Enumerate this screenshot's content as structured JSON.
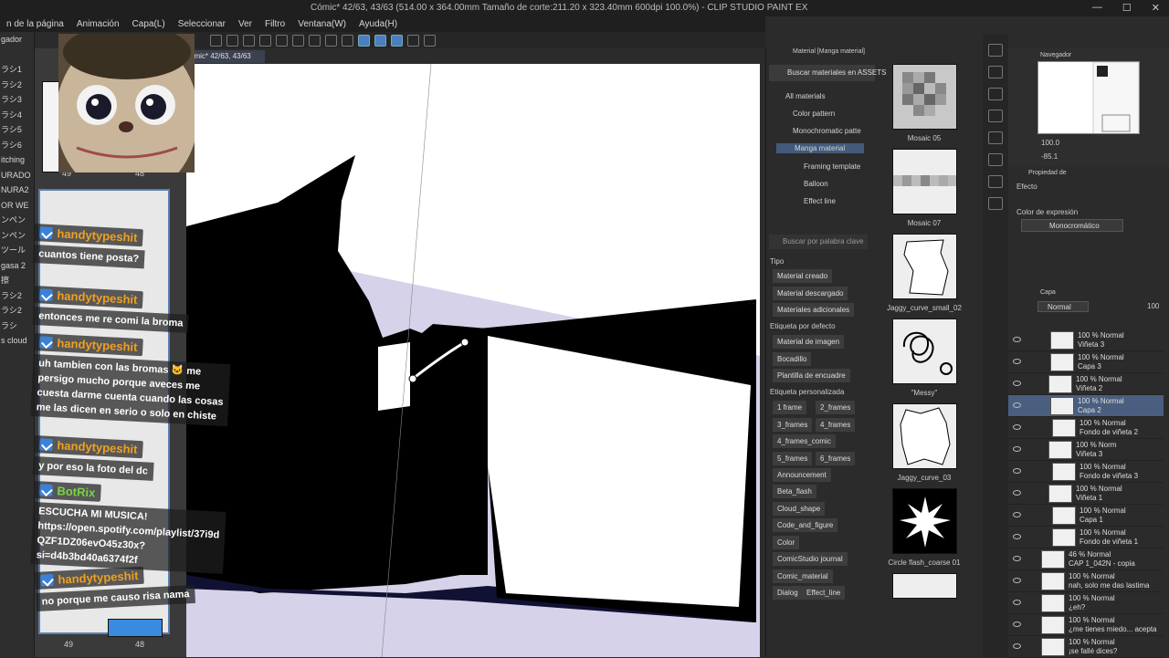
{
  "window": {
    "title": "Cómic* 42/63, 43/63 (514.00 x 364.00mm Tamaño de corte:211.20 x 323.40mm 600dpi 100.0%) - CLIP STUDIO PAINT EX",
    "controls": [
      "—",
      "☐",
      "✕"
    ]
  },
  "menu": [
    "n de la página",
    "Animación",
    "Capa(L)",
    "Seleccionar",
    "Ver",
    "Filtro",
    "Ventana(W)",
    "Ayuda(H)"
  ],
  "document_tab": "ómic* 42/63, 43/63",
  "left_panel": [
    "gador",
    "",
    "ラシ1",
    "ラシ2",
    "ラシ3",
    "ラシ4",
    "ラシ5",
    "ラシ6",
    "itching",
    "URADO",
    "NURA2",
    "OR WE",
    "ンペン",
    "ンペン",
    "ツール",
    "gasa 2",
    "擦",
    "ラシ2",
    "ラシ2",
    "ラシ",
    "s cloud"
  ],
  "page_numbers": {
    "top_left": "49",
    "top_right": "48",
    "bottom_left": "49",
    "bottom_right": "48"
  },
  "chat": [
    {
      "user": "",
      "text": "cuantos tiene posta?",
      "top_label": "handytypeshit"
    },
    {
      "user": "handytypeshit",
      "text": "entonces me re comi la broma"
    },
    {
      "user": "handytypeshit",
      "text": "uh tambien con las bromas 🐱 me\npersigo mucho porque aveces me\ncuesta darme cuenta cuando las cosas\nme las dicen en serio o solo en chiste"
    },
    {
      "user": "handytypeshit",
      "text": "y por eso la foto del dc"
    },
    {
      "user": "BotRix",
      "text": "ESCUCHA MI MUSICA!\nhttps://open.spotify.com/playlist/37i9d\nQZF1DZ06evO45z30x?\nsi=d4b3bd40a6374f2f"
    },
    {
      "user": "handytypeshit",
      "text": "no porque me causo risa nama"
    }
  ],
  "materials": {
    "header": "Material [Manga material]",
    "assets_button": "Buscar materiales en ASSETS",
    "tree": [
      {
        "label": "All materials",
        "selected": false
      },
      {
        "label": "Color pattern",
        "selected": false
      },
      {
        "label": "Monochromatic patte",
        "selected": false
      },
      {
        "label": "Manga material",
        "selected": true
      },
      {
        "label": "Framing template",
        "selected": false
      },
      {
        "label": "Balloon",
        "selected": false
      },
      {
        "label": "Effect line",
        "selected": false
      }
    ],
    "search_placeholder": "Buscar por palabra clave",
    "tipo_label": "Tipo",
    "tipo_tags": [
      "Material creado",
      "Material descargado",
      "Materiales adicionales"
    ],
    "default_label": "Etiqueta por defecto",
    "default_tags": [
      "Material de imagen",
      "Bocadillo",
      "Plantilla de encuadre"
    ],
    "custom_label": "Etiqueta personalizada",
    "custom_tags": [
      "1 frame",
      "2_frames",
      "3_frames",
      "4_frames",
      "4_frames_comic",
      "5_frames",
      "6_frames",
      "Announcement",
      "Beta_flash",
      "Cloud_shape",
      "Code_and_figure",
      "Color",
      "ComicStudio journal",
      "Comic_material",
      "Dialog",
      "Effect_line"
    ],
    "thumbnails": [
      "Mosaic 05",
      "Mosaic 07",
      "Jaggy_curve_small_02",
      "\"Messy\"",
      "Jaggy_curve_03",
      "Circle flash_coarse 01"
    ]
  },
  "navigator": {
    "label": "Navegador",
    "zoom": "100.0",
    "rotation": "-85.1"
  },
  "property": {
    "label": "Propiedad de",
    "effect_label": "Efecto",
    "color_expression_label": "Color de expresión",
    "color_expression_value": "Monocromático"
  },
  "layers": {
    "label": "Capa",
    "blend_mode": "Normal",
    "opacity": "100",
    "items": [
      {
        "line1": "100 % Normal",
        "line2": "Viñeta 3",
        "indent": 0,
        "selected": false
      },
      {
        "line1": "100 % Normal",
        "line2": "Capa 3",
        "indent": 0,
        "selected": false
      },
      {
        "line1": "100 % Normal",
        "line2": "Viñeta 2",
        "indent": 1,
        "selected": false
      },
      {
        "line1": "100 % Normal",
        "line2": "Capa 2",
        "indent": 2,
        "selected": true
      },
      {
        "line1": "100 % Normal",
        "line2": "Fondo de viñeta 2",
        "indent": 2,
        "selected": false
      },
      {
        "line1": "100 % Norm",
        "line2": "Viñeta 3",
        "indent": 1,
        "selected": false
      },
      {
        "line1": "100 % Normal",
        "line2": "Fondo de viñeta 3",
        "indent": 2,
        "selected": false
      },
      {
        "line1": "100 % Normal",
        "line2": "Viñeta 1",
        "indent": 1,
        "selected": false
      },
      {
        "line1": "100 % Normal",
        "line2": "Capa 1",
        "indent": 2,
        "selected": false
      },
      {
        "line1": "100 % Normal",
        "line2": "Fondo de viñeta 1",
        "indent": 2,
        "selected": false
      },
      {
        "line1": "46 % Normal",
        "line2": "CAP 1_042N - copia",
        "indent": 0,
        "selected": false
      },
      {
        "line1": "100 % Normal",
        "line2": "nah, solo me das lastima",
        "indent": 0,
        "selected": false
      },
      {
        "line1": "100 % Normal",
        "line2": "¿eh?",
        "indent": 0,
        "selected": false
      },
      {
        "line1": "100 % Normal",
        "line2": "¿me tienes miedo... acepta",
        "indent": 0,
        "selected": false
      },
      {
        "line1": "100 % Normal",
        "line2": "¡se fallé dices?",
        "indent": 0,
        "selected": false
      }
    ]
  },
  "colors": {
    "accent": "#4a7fc0",
    "username": "#f0a020",
    "bot": "#7cd34a",
    "selected_layer": "#4a5f80",
    "canvas_bg": "#d6d2ea"
  }
}
